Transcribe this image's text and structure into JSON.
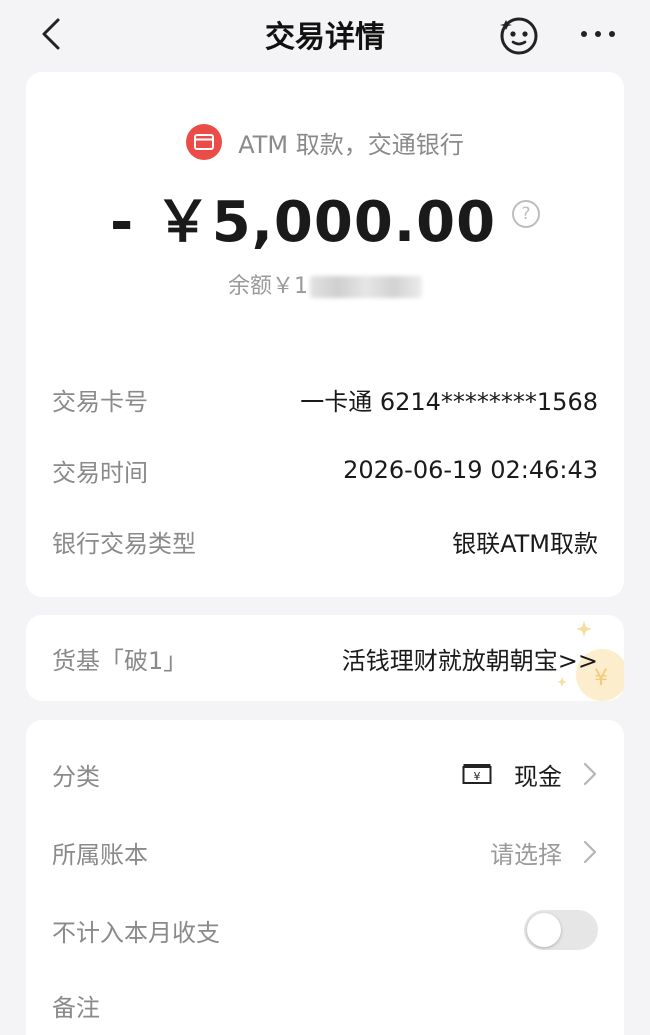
{
  "nav": {
    "title": "交易详情"
  },
  "transaction": {
    "source": "ATM 取款，交通银行",
    "amount": "- ￥5,000.00",
    "balance_label": "余额￥",
    "balance_value": "1"
  },
  "details": [
    {
      "label": "交易卡号",
      "value": "一卡通 6214********1568"
    },
    {
      "label": "交易时间",
      "value": "2026-06-19 02:46:43"
    },
    {
      "label": "银行交易类型",
      "value": "银联ATM取款"
    }
  ],
  "promo": {
    "label": "货基「破1」",
    "link": "活钱理财就放朝朝宝>>"
  },
  "settings": {
    "category_label": "分类",
    "category_value": "现金",
    "book_label": "所属账本",
    "book_placeholder": "请选择",
    "exclude_label": "不计入本月收支",
    "exclude_on": false,
    "note_label": "备注"
  },
  "colors": {
    "accent_red": "#ec4c47",
    "background": "#f4f4f6"
  },
  "icons": [
    "back-icon",
    "bot-face-icon",
    "more-icon",
    "bank-card-icon",
    "help-icon",
    "cash-icon",
    "chevron-right-icon"
  ]
}
